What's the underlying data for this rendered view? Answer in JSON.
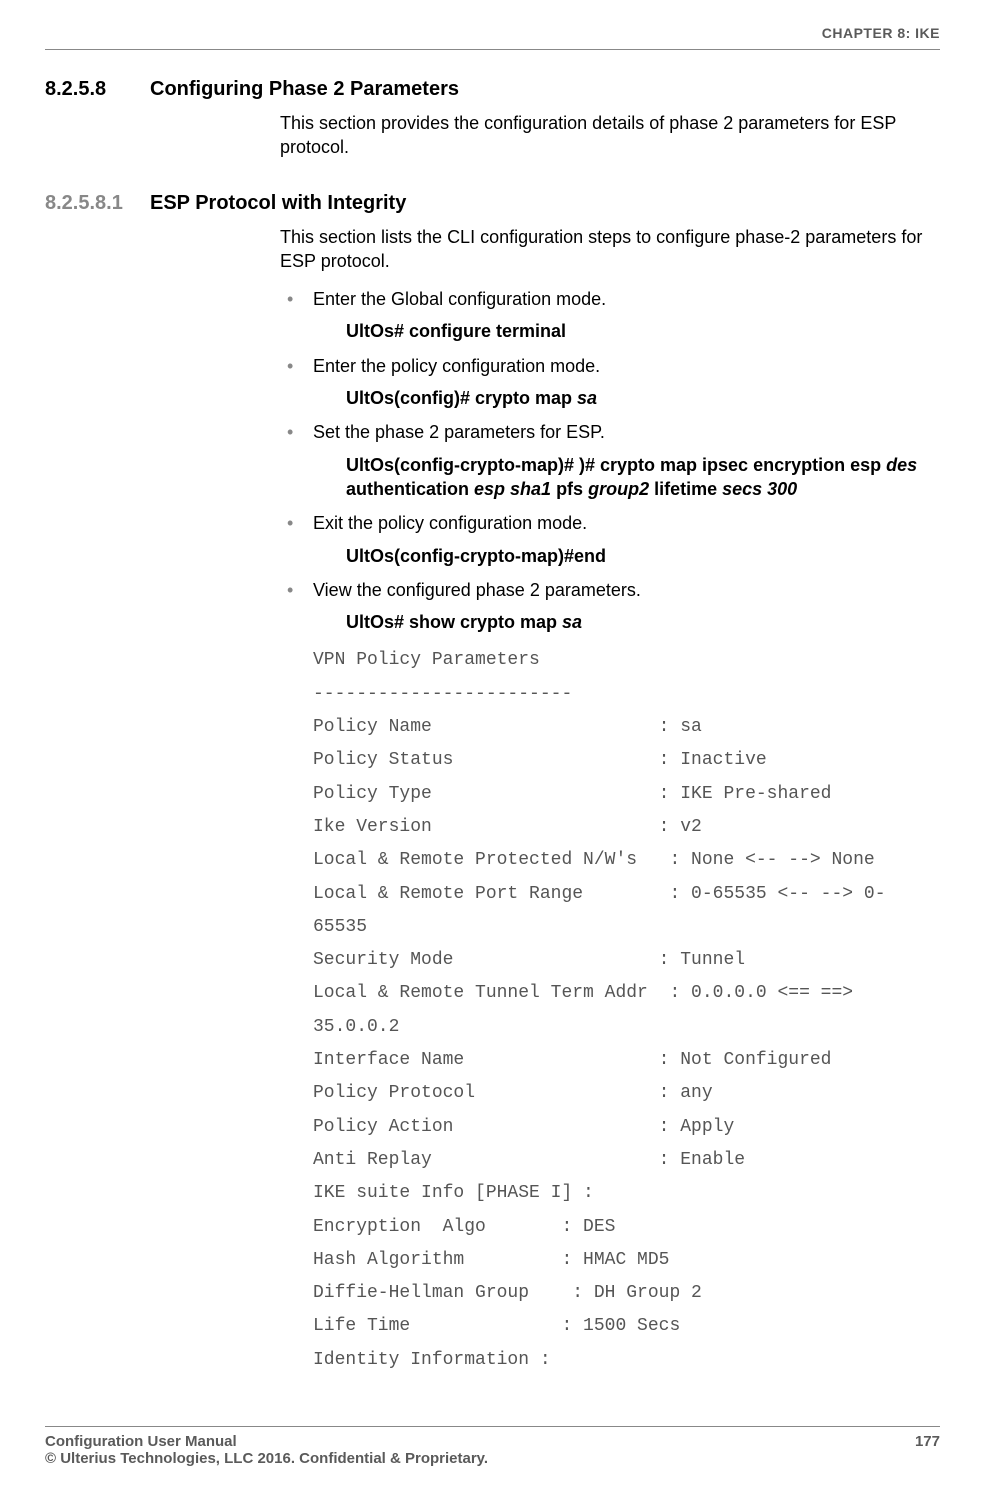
{
  "header": {
    "chapter": "CHAPTER 8: IKE"
  },
  "section1": {
    "num": "8.2.5.8",
    "title": "Configuring Phase 2 Parameters",
    "intro": "This section provides the configuration details of phase 2 parameters for ESP protocol."
  },
  "section2": {
    "num": "8.2.5.8.1",
    "title": "ESP Protocol with Integrity",
    "intro": "This section lists the CLI configuration steps to configure phase-2 parameters for ESP protocol.",
    "steps": [
      {
        "text": "Enter the Global configuration mode.",
        "cmd_bold": "UltOs# configure terminal",
        "cmd_ital": ""
      },
      {
        "text": "Enter the policy configuration mode.",
        "cmd_bold": "UltOs(config)# crypto map ",
        "cmd_ital": "sa"
      },
      {
        "text": "Set the phase 2 parameters for ESP.",
        "cmd_bold_1": "UltOs(config-crypto-map)# )# crypto map ipsec encryption esp ",
        "cmd_ital_1": "des",
        "cmd_bold_2": " authentication ",
        "cmd_ital_2": "esp sha1",
        "cmd_bold_3": " pfs ",
        "cmd_ital_3": "group2",
        "cmd_bold_4": " lifetime ",
        "cmd_ital_4": "secs 300"
      },
      {
        "text": "Exit the policy configuration mode.",
        "cmd_bold": "UltOs(config-crypto-map)#end",
        "cmd_ital": ""
      },
      {
        "text": "View the configured phase 2 parameters.",
        "cmd_bold": "UltOs# show crypto map ",
        "cmd_ital": "sa"
      }
    ],
    "output": "VPN Policy Parameters\n------------------------\nPolicy Name                     : sa\nPolicy Status                   : Inactive\nPolicy Type                     : IKE Pre-shared\nIke Version                     : v2\nLocal & Remote Protected N/W's   : None <-- --> None\nLocal & Remote Port Range        : 0-65535 <-- --> 0-\n65535\nSecurity Mode                   : Tunnel\nLocal & Remote Tunnel Term Addr  : 0.0.0.0 <== ==>\n35.0.0.2\nInterface Name                  : Not Configured\nPolicy Protocol                 : any\nPolicy Action                   : Apply\nAnti Replay                     : Enable\nIKE suite Info [PHASE I] :\nEncryption  Algo       : DES\nHash Algorithm         : HMAC MD5\nDiffie-Hellman Group    : DH Group 2\nLife Time              : 1500 Secs\nIdentity Information :"
  },
  "footer": {
    "left1": "Configuration User Manual",
    "left2": "© Ulterius Technologies, LLC 2016. Confidential & Proprietary.",
    "right": "177"
  }
}
